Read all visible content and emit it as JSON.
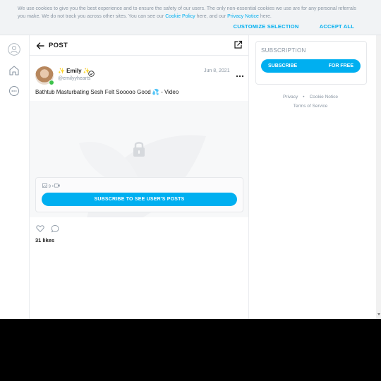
{
  "cookie_banner": {
    "text_before": "We use cookies to give you the best experience and to ensure the safety of our users. The only non-essential cookies we use are for any personal referrals you make. We do not track you across other sites. You can see our ",
    "cookie_policy": "Cookie Policy",
    "text_middle": " here, and our ",
    "privacy_notice": "Privacy Notice",
    "text_after": " here.",
    "customize": "CUSTOMIZE SELECTION",
    "accept": "ACCEPT ALL"
  },
  "header": {
    "title": "POST"
  },
  "post": {
    "author_name": "✨ Emily ✨",
    "handle": "@emilyyhearts",
    "date": "Jun 8, 2021",
    "text": "Bathtub Masturbating Sesh Felt Sooooo Good 💦 - Video",
    "media_count": "9",
    "subscribe_label": "SUBSCRIBE TO SEE USER'S POSTS",
    "likes": "31 likes"
  },
  "sidebar": {
    "title": "SUBSCRIPTION",
    "subscribe": "SUBSCRIBE",
    "price": "FOR FREE",
    "links": [
      "Privacy",
      "Cookie Notice",
      "Terms of Service"
    ]
  },
  "colors": {
    "accent": "#00aff0",
    "online": "#3cc24a",
    "muted": "#8a96a3"
  }
}
